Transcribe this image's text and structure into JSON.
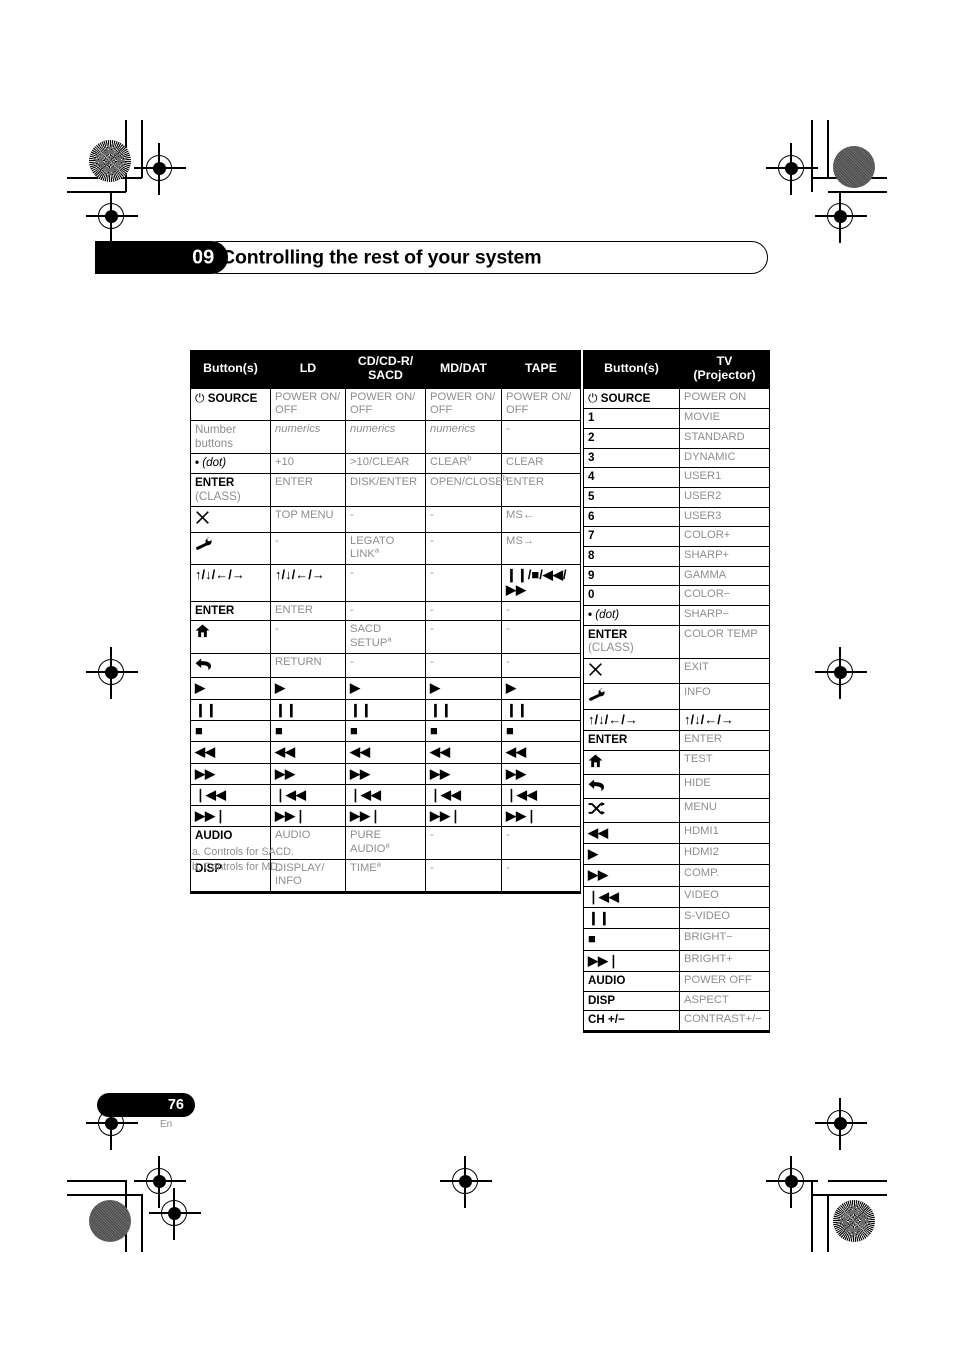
{
  "header": {
    "chapter_number": "09",
    "chapter_title": "Controlling the rest of your system"
  },
  "footer": {
    "page_number": "76",
    "language": "En"
  },
  "footnotes": [
    "a. Controls for SACD.",
    "b. Controls for MD."
  ],
  "left_table": {
    "headers": [
      "Button(s)",
      "LD",
      "CD/CD-R/\nSACD",
      "MD/DAT",
      "TAPE"
    ],
    "header_cd_line1": "CD/CD-R/",
    "header_cd_line2": "SACD",
    "rows": [
      {
        "button": "SOURCE",
        "button_icon": "power-icon",
        "ld": "POWER ON/ OFF",
        "cd": "POWER ON/ OFF",
        "md": "POWER ON/ OFF",
        "tape": "POWER ON/ OFF"
      },
      {
        "button": "Number buttons",
        "ld": "numerics",
        "cd": "numerics",
        "md": "numerics",
        "tape": "-"
      },
      {
        "button": "• (dot)",
        "ld": "+10",
        "cd": ">10/CLEAR",
        "md": "CLEAR",
        "md_sup": "b",
        "tape": "CLEAR"
      },
      {
        "button": "ENTER (CLASS)",
        "ld": "ENTER",
        "cd": "DISK/ENTER",
        "md": "OPEN/CLOSE",
        "md_sup": "b",
        "tape": "ENTER"
      },
      {
        "button": "✕",
        "button_icon": "close-x-icon",
        "ld": "TOP MENU",
        "cd": "-",
        "md": "-",
        "tape": "MS←"
      },
      {
        "button": "wrench",
        "button_icon": "wrench-icon",
        "ld": "-",
        "cd": "LEGATO LINK",
        "cd_sup": "a",
        "md": "-",
        "tape": "MS→"
      },
      {
        "button": "↑/↓/←/→",
        "button_icon": "arrows-icon",
        "ld": "↑/↓/←/→",
        "cd": "-",
        "md": "-",
        "tape": "❙❙/■/◀◀/▶▶"
      },
      {
        "button": "ENTER",
        "ld": "ENTER",
        "cd": "-",
        "md": "-",
        "tape": "-"
      },
      {
        "button": "home",
        "button_icon": "home-icon",
        "ld": "-",
        "cd": "SACD SETUP",
        "cd_sup": "a",
        "md": "-",
        "tape": "-"
      },
      {
        "button": "return",
        "button_icon": "return-arrow-icon",
        "ld": "RETURN",
        "cd": "-",
        "md": "-",
        "tape": "-"
      },
      {
        "button": "▶",
        "button_icon": "play-icon",
        "ld": "▶",
        "cd": "▶",
        "md": "▶",
        "tape": "▶"
      },
      {
        "button": "❙❙",
        "button_icon": "pause-icon",
        "ld": "❙❙",
        "cd": "❙❙",
        "md": "❙❙",
        "tape": "❙❙"
      },
      {
        "button": "■",
        "button_icon": "stop-icon",
        "ld": "■",
        "cd": "■",
        "md": "■",
        "tape": "■"
      },
      {
        "button": "◀◀",
        "button_icon": "rewind-icon",
        "ld": "◀◀",
        "cd": "◀◀",
        "md": "◀◀",
        "tape": "◀◀"
      },
      {
        "button": "▶▶",
        "button_icon": "fast-forward-icon",
        "ld": "▶▶",
        "cd": "▶▶",
        "md": "▶▶",
        "tape": "▶▶"
      },
      {
        "button": "❘◀◀",
        "button_icon": "previous-track-icon",
        "ld": "❘◀◀",
        "cd": "❘◀◀",
        "md": "❘◀◀",
        "tape": "❘◀◀"
      },
      {
        "button": "▶▶❘",
        "button_icon": "next-track-icon",
        "ld": "▶▶❘",
        "cd": "▶▶❘",
        "md": "▶▶❘",
        "tape": "▶▶❘"
      },
      {
        "button": "AUDIO",
        "ld": "AUDIO",
        "cd": "PURE AUDIO",
        "cd_sup": "a",
        "md": "-",
        "tape": "-"
      },
      {
        "button": "DISP",
        "ld": "DISPLAY/ INFO",
        "cd": "TIME",
        "cd_sup": "a",
        "md": "-",
        "tape": "-"
      }
    ]
  },
  "right_table": {
    "headers": [
      "Button(s)",
      "TV\n(Projector)"
    ],
    "header_tv_line1": "TV",
    "header_tv_line2": "(Projector)",
    "rows": [
      {
        "button": "SOURCE",
        "button_icon": "power-icon",
        "tv": "POWER ON"
      },
      {
        "button": "1",
        "tv": "MOVIE"
      },
      {
        "button": "2",
        "tv": "STANDARD"
      },
      {
        "button": "3",
        "tv": "DYNAMIC"
      },
      {
        "button": "4",
        "tv": "USER1"
      },
      {
        "button": "5",
        "tv": "USER2"
      },
      {
        "button": "6",
        "tv": "USER3"
      },
      {
        "button": "7",
        "tv": "COLOR+"
      },
      {
        "button": "8",
        "tv": "SHARP+"
      },
      {
        "button": "9",
        "tv": "GAMMA"
      },
      {
        "button": "0",
        "tv": "COLOR−"
      },
      {
        "button": "• (dot)",
        "tv": "SHARP−"
      },
      {
        "button": "ENTER (CLASS)",
        "tv": "COLOR TEMP"
      },
      {
        "button": "✕",
        "button_icon": "close-x-icon",
        "tv": "EXIT"
      },
      {
        "button": "wrench",
        "button_icon": "wrench-icon",
        "tv": "INFO"
      },
      {
        "button": "↑/↓/←/→",
        "button_icon": "arrows-icon",
        "tv": "↑/↓/←/→"
      },
      {
        "button": "ENTER",
        "tv": "ENTER"
      },
      {
        "button": "home",
        "button_icon": "home-icon",
        "tv": "TEST"
      },
      {
        "button": "return",
        "button_icon": "return-arrow-icon",
        "tv": "HIDE"
      },
      {
        "button": "shuffle",
        "button_icon": "shuffle-icon",
        "tv": "MENU"
      },
      {
        "button": "◀◀",
        "button_icon": "rewind-icon",
        "tv": "HDMI1"
      },
      {
        "button": "▶",
        "button_icon": "play-icon",
        "tv": "HDMI2"
      },
      {
        "button": "▶▶",
        "button_icon": "fast-forward-icon",
        "tv": "COMP."
      },
      {
        "button": "❘◀◀",
        "button_icon": "previous-track-icon",
        "tv": "VIDEO"
      },
      {
        "button": "❙❙",
        "button_icon": "pause-icon",
        "tv": "S-VIDEO"
      },
      {
        "button": "■",
        "button_icon": "stop-icon",
        "tv": "BRIGHT−"
      },
      {
        "button": "▶▶❘",
        "button_icon": "next-track-icon",
        "tv": "BRIGHT+"
      },
      {
        "button": "AUDIO",
        "tv": "POWER OFF"
      },
      {
        "button": "DISP",
        "tv": "ASPECT"
      },
      {
        "button": "CH +/−",
        "tv": "CONTRAST+/−"
      }
    ]
  }
}
